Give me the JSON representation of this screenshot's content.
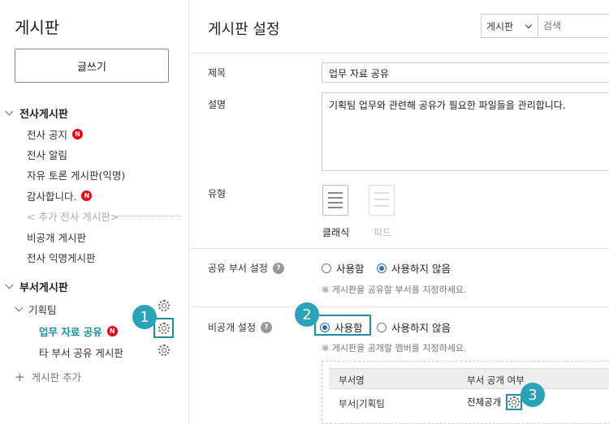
{
  "sidebar": {
    "title": "게시판",
    "write_button": "글쓰기",
    "section_company": "전사게시판",
    "company_items": [
      "전사 공지",
      "전사 알림",
      "자유 토론 게시판(익명)",
      "감사합니다.",
      "< 추가 전사 게시판>",
      "비공개 게시판",
      "전사 익명게시판"
    ],
    "badge": "N",
    "section_dept": "부서게시판",
    "dept_group": "기획팀",
    "dept_items": [
      "업무 자료 공유",
      "타 부서 공유 게시판"
    ],
    "add_board": "게시판 추가"
  },
  "main": {
    "title": "게시판 설정",
    "search_select": "게시판",
    "search_placeholder": "검색",
    "label_title": "제목",
    "value_title": "업무 자료 공유",
    "label_desc": "설명",
    "value_desc": "기획팀 업무와 관련해 공유가 필요한 파일들을 관리합니다.",
    "label_type": "유형",
    "type_classic": "클래식",
    "type_feed": "피드",
    "label_share": "공유 부서 설정",
    "radio_use": "사용함",
    "radio_nouse": "사용하지 않음",
    "hint_share": "※ 게시판을 공유할 부서를 지정하세요.",
    "label_private": "비공개 설정",
    "hint_private": "※ 게시판을 공개할 멤버를 지정하세요.",
    "table_head_dept": "부서명",
    "table_head_public": "부서 공개 여부",
    "table_row_dept": "부서|기획팀",
    "table_row_public": "전체공개",
    "help_glyph": "?"
  },
  "callouts": [
    "1",
    "2",
    "3"
  ],
  "colors": {
    "accent": "#1d8fa4",
    "callout": "#2aa2b8",
    "badge": "#e60012",
    "radio": "#2b6cb0"
  }
}
